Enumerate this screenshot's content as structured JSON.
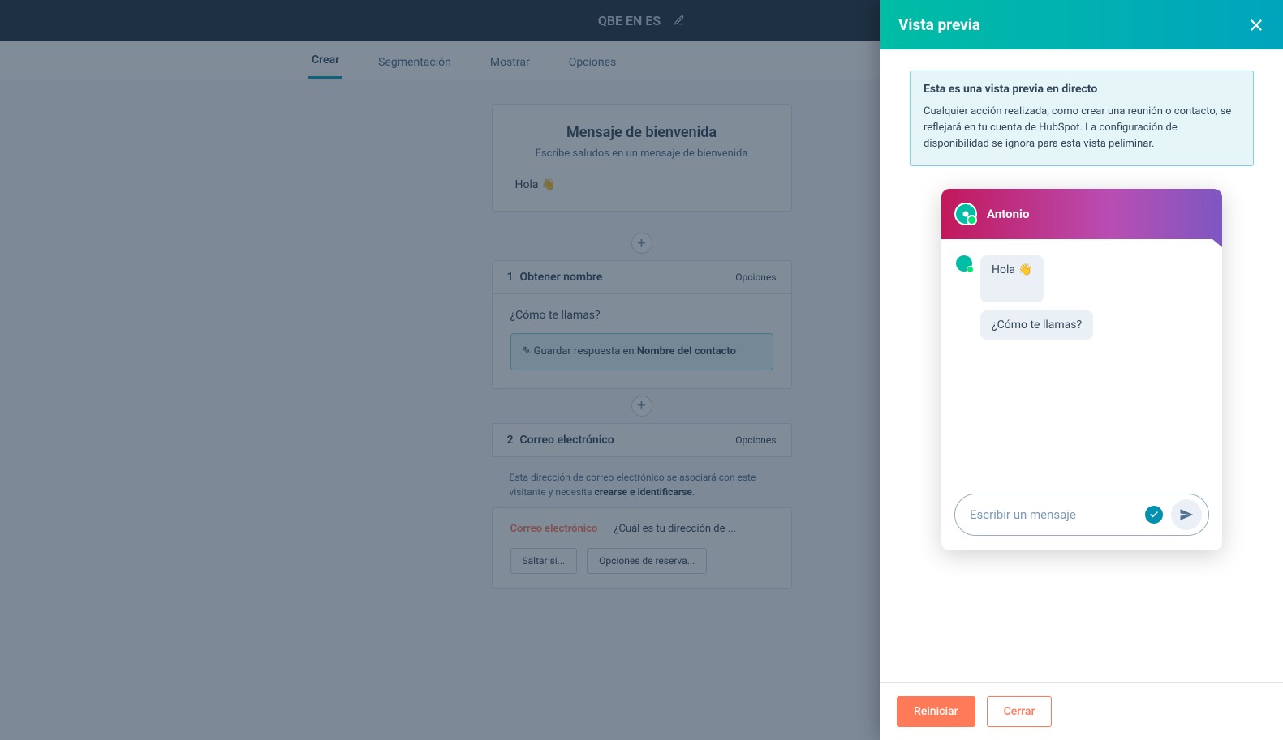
{
  "topbar": {
    "title": "QBE EN ES"
  },
  "tabs": {
    "items": [
      "Crear",
      "Segmentación",
      "Mostrar",
      "Opciones"
    ],
    "active_index": 0
  },
  "welcome_card": {
    "title": "Mensaje de bienvenida",
    "desc": "Escribe saludos en un mensaje de bienvenida",
    "message": "Hola 👋"
  },
  "step1": {
    "index": "1",
    "label": "Obtener nombre",
    "actions": "Opciones",
    "prompt": "¿Cómo te llamas?",
    "response_prefix": "Guardar respuesta en",
    "response_field": "Nombre del contacto"
  },
  "step2": {
    "index": "2",
    "label": "Correo electrónico",
    "actions": "Opciones",
    "desc_para_a": "Esta dirección de correo electrónico se asociará con este visitante y necesita",
    "desc_para_b": "crearse e identificarse",
    "email_row_label": "Correo electrónico",
    "email_row_q": "¿Cuál es tu dirección de ...",
    "opt_salt": "Saltar si...",
    "opt_alt": "Opciones de reserva..."
  },
  "preview": {
    "header": "Vista previa",
    "banner_title": "Esta es una vista previa en directo",
    "banner_body": "Cualquier acción realizada, como crear una reunión o contacto, se reflejará en tu cuenta de HubSpot. La configuración de disponibilidad se ignora para esta vista peliminar.",
    "agent_name": "Antonio",
    "bubble1": "Hola 👋",
    "bubble2": "¿Cómo te llamas?",
    "input_placeholder": "Escribir un mensaje",
    "btn_restart": "Reiniciar",
    "btn_close": "Cerrar"
  }
}
